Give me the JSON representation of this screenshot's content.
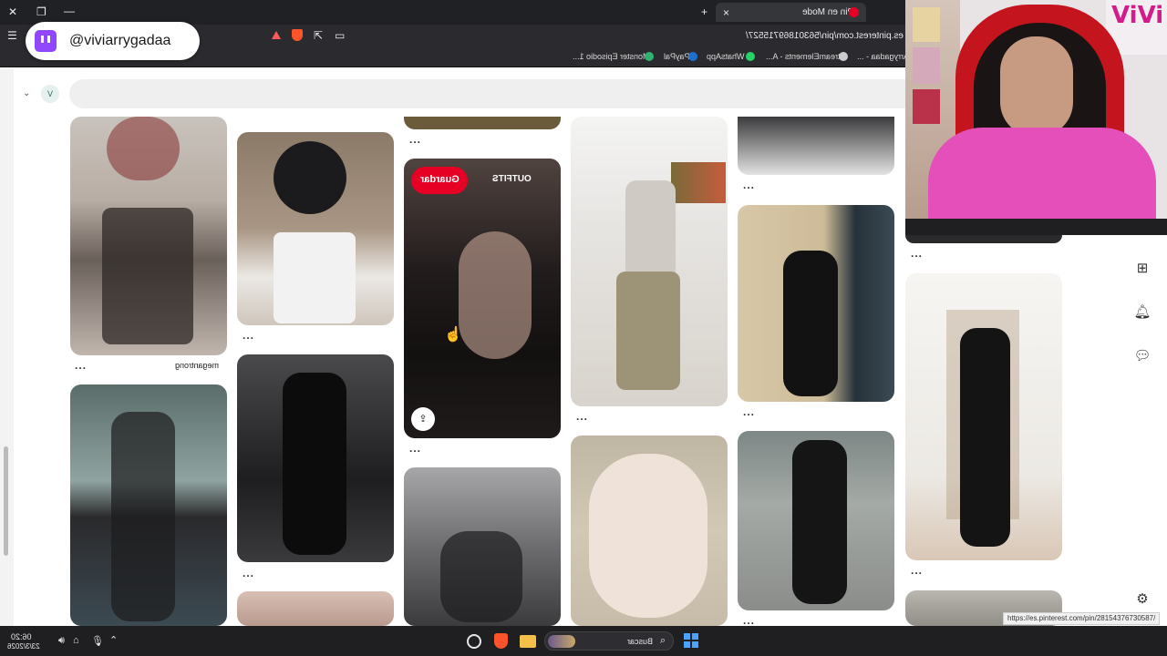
{
  "browser": {
    "tab_title": "Pin en Mode",
    "url": "es.pinterest.com/pin/56301869715527/",
    "bookmarks": [
      "ViviArrygadaa - ...",
      "StreamElements - A...",
      "WhatsApp",
      "PayPal",
      "Monster Episodio 1..."
    ],
    "new_tab_label": "+",
    "close_label": "×"
  },
  "stream": {
    "handle": "@viviarrygadaa"
  },
  "pinterest": {
    "avatar_letter": "V",
    "search_placeholder": "",
    "board_label": "OUTFITS",
    "save_label": "Guardar",
    "more_label": "...",
    "pin_caption": "megantrong"
  },
  "status_url": "https://es.pinterest.com/pin/28154376730587/",
  "taskbar": {
    "search_label": "Buscar",
    "time": "06:20",
    "date": "23/3/2026"
  },
  "colors": {
    "pinterest_red": "#e60023",
    "twitch_purple": "#9146ff"
  }
}
